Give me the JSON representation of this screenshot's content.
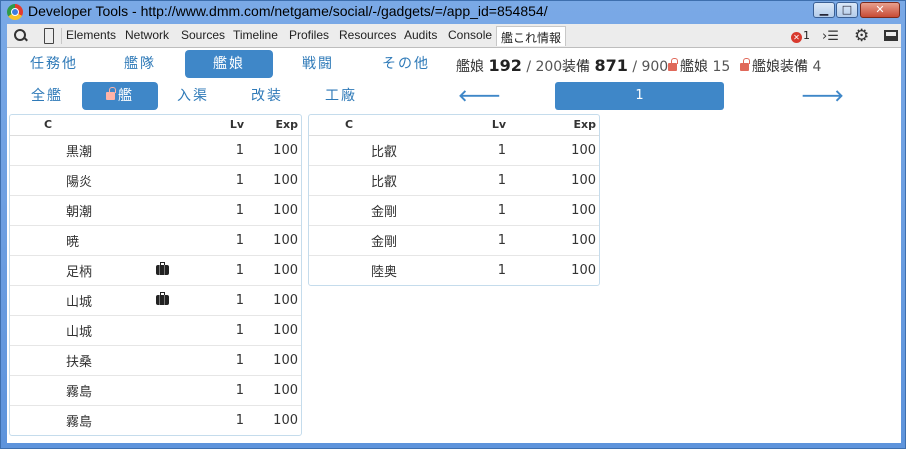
{
  "window": {
    "title": "Developer Tools - http://www.dmm.com/netgame/social/-/gadgets/=/app_id=854854/",
    "min_label": "▁",
    "max_label": "□",
    "close_label": "✕"
  },
  "devtools": {
    "tabs": [
      "Elements",
      "Network",
      "Sources",
      "Timeline",
      "Profiles",
      "Resources",
      "Audits",
      "Console",
      "艦これ情報"
    ],
    "active_tab": "艦これ情報",
    "error_count": "1"
  },
  "nav": {
    "main_tabs": [
      "任務他",
      "艦隊",
      "艦娘",
      "戦闘",
      "その他"
    ],
    "active_main": "艦娘",
    "sub_tabs": [
      "全艦",
      "艦",
      "入渠",
      "改装",
      "工廠"
    ],
    "active_sub": "艦"
  },
  "stats": {
    "ship_label": "艦娘",
    "ship_count": "192",
    "ship_max": "/ 200",
    "equip_label": "装備",
    "equip_count": "871",
    "equip_max": "/ 900",
    "locked_ships_label": "艦娘",
    "locked_ships": "15",
    "locked_equip_label": "艦娘装備",
    "locked_equip": "4"
  },
  "pager": {
    "prev_icon": "arrow-left",
    "next_icon": "arrow-right",
    "current_page": "1"
  },
  "table_headers": {
    "c": "C",
    "lv": "Lv",
    "exp": "Exp"
  },
  "left_table": [
    {
      "name": "黒潮",
      "case": false,
      "lv": "1",
      "exp": "100"
    },
    {
      "name": "陽炎",
      "case": false,
      "lv": "1",
      "exp": "100"
    },
    {
      "name": "朝潮",
      "case": false,
      "lv": "1",
      "exp": "100"
    },
    {
      "name": "暁",
      "case": false,
      "lv": "1",
      "exp": "100"
    },
    {
      "name": "足柄",
      "case": true,
      "lv": "1",
      "exp": "100"
    },
    {
      "name": "山城",
      "case": true,
      "lv": "1",
      "exp": "100"
    },
    {
      "name": "山城",
      "case": false,
      "lv": "1",
      "exp": "100"
    },
    {
      "name": "扶桑",
      "case": false,
      "lv": "1",
      "exp": "100"
    },
    {
      "name": "霧島",
      "case": false,
      "lv": "1",
      "exp": "100"
    },
    {
      "name": "霧島",
      "case": false,
      "lv": "1",
      "exp": "100"
    }
  ],
  "right_table": [
    {
      "name": "比叡",
      "lv": "1",
      "exp": "100"
    },
    {
      "name": "比叡",
      "lv": "1",
      "exp": "100"
    },
    {
      "name": "金剛",
      "lv": "1",
      "exp": "100"
    },
    {
      "name": "金剛",
      "lv": "1",
      "exp": "100"
    },
    {
      "name": "陸奥",
      "lv": "1",
      "exp": "100"
    }
  ],
  "colors": {
    "accent": "#3f87c8",
    "lock": "#e0695a"
  }
}
